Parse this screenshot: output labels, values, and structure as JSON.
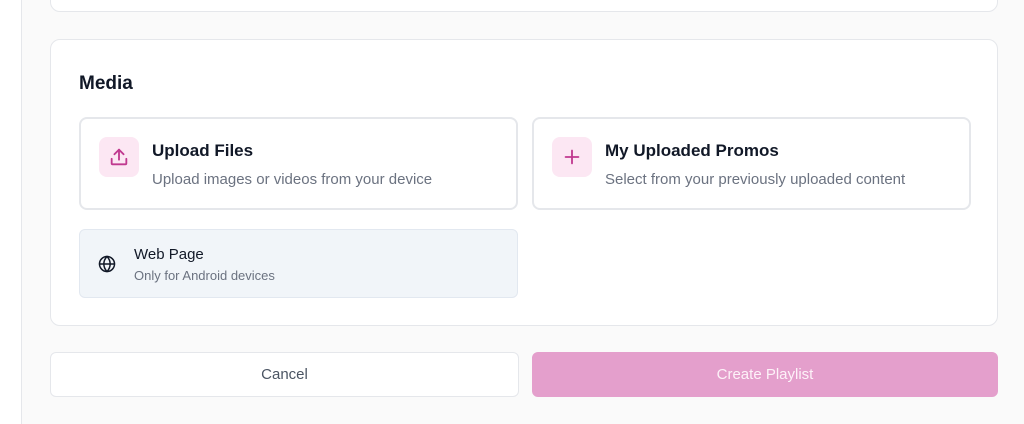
{
  "media": {
    "title": "Media",
    "options": [
      {
        "icon": "upload-icon",
        "title": "Upload Files",
        "description": "Upload images or videos from your device"
      },
      {
        "icon": "plus-icon",
        "title": "My Uploaded Promos",
        "description": "Select from your previously uploaded content"
      }
    ],
    "web_page": {
      "icon": "globe-icon",
      "title": "Web Page",
      "description": "Only for Android devices"
    }
  },
  "actions": {
    "cancel_label": "Cancel",
    "create_label": "Create Playlist"
  },
  "colors": {
    "accent": "#c0398f",
    "accent_soft": "#fce7f3",
    "create_button": "#e49fcc"
  }
}
